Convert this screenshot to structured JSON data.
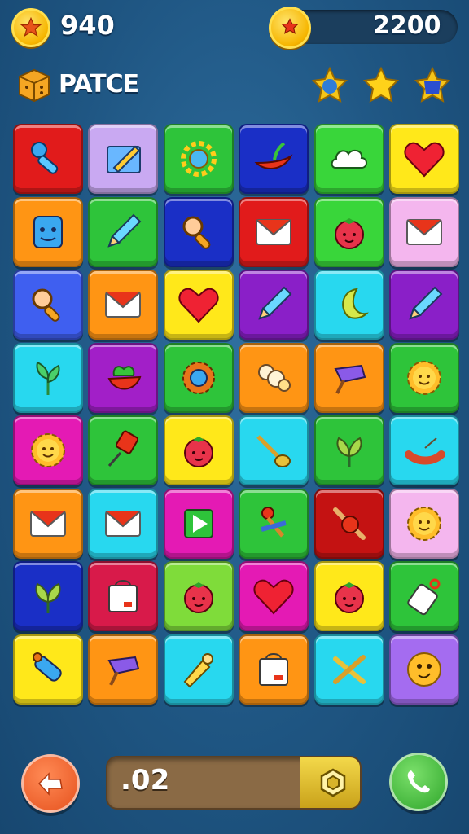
{
  "hud": {
    "coins": "940",
    "score": "2200",
    "level_label": "PATCE"
  },
  "stars": [
    "blue-star-icon",
    "gold-star-icon",
    "blue-cracked-star-icon"
  ],
  "board": {
    "columns": 6,
    "rows": 8,
    "tiles": [
      {
        "color": "#e11b1b",
        "icon": "key-icon"
      },
      {
        "color": "#c9a9f2",
        "icon": "edit-pencil-icon"
      },
      {
        "color": "#2ec43a",
        "icon": "sun-icon"
      },
      {
        "color": "#1a2fc6",
        "icon": "chili-pepper-icon"
      },
      {
        "color": "#39d63a",
        "icon": "cloud-icon"
      },
      {
        "color": "#ffe81a",
        "icon": "heart-icon"
      },
      {
        "color": "#ff9514",
        "icon": "robot-face-icon"
      },
      {
        "color": "#2ec43a",
        "icon": "pencil-icon"
      },
      {
        "color": "#1a2fc6",
        "icon": "magnifier-icon"
      },
      {
        "color": "#e11b1b",
        "icon": "envelope-icon"
      },
      {
        "color": "#39d63a",
        "icon": "tomato-face-icon"
      },
      {
        "color": "#f4b6ee",
        "icon": "envelope-icon"
      },
      {
        "color": "#3f5ff0",
        "icon": "magnifier-icon"
      },
      {
        "color": "#ff9514",
        "icon": "envelope-icon"
      },
      {
        "color": "#ffe81a",
        "icon": "heart-icon"
      },
      {
        "color": "#8a1fc8",
        "icon": "pencil-icon"
      },
      {
        "color": "#28d8ef",
        "icon": "moon-icon"
      },
      {
        "color": "#8a1fc8",
        "icon": "pencil-icon"
      },
      {
        "color": "#28d8ef",
        "icon": "sprout-icon"
      },
      {
        "color": "#a21fc8",
        "icon": "cherry-leaf-icon"
      },
      {
        "color": "#2ec43a",
        "icon": "gear-icon"
      },
      {
        "color": "#ff9514",
        "icon": "puff-cloud-icon"
      },
      {
        "color": "#ff9514",
        "icon": "paint-brush-icon"
      },
      {
        "color": "#2ec43a",
        "icon": "smiley-sun-icon"
      },
      {
        "color": "#e41ab4",
        "icon": "smiley-sun-icon"
      },
      {
        "color": "#2ec43a",
        "icon": "pushpin-icon"
      },
      {
        "color": "#ffe81a",
        "icon": "tomato-face-icon"
      },
      {
        "color": "#28d8ef",
        "icon": "spoon-icon"
      },
      {
        "color": "#2ec43a",
        "icon": "leaf-icon"
      },
      {
        "color": "#28d8ef",
        "icon": "sausage-icon"
      },
      {
        "color": "#ff9514",
        "icon": "envelope-icon"
      },
      {
        "color": "#28d8ef",
        "icon": "envelope-icon"
      },
      {
        "color": "#e41ab4",
        "icon": "play-icon"
      },
      {
        "color": "#2ec43a",
        "icon": "tools-icon"
      },
      {
        "color": "#c41212",
        "icon": "rolling-pin-icon"
      },
      {
        "color": "#f4b6ee",
        "icon": "smiley-sun-icon"
      },
      {
        "color": "#1a2fc6",
        "icon": "leaf-icon"
      },
      {
        "color": "#d81a4a",
        "icon": "shopping-bag-icon"
      },
      {
        "color": "#7fdc3a",
        "icon": "tomato-face-icon"
      },
      {
        "color": "#e41ab4",
        "icon": "heart-icon"
      },
      {
        "color": "#ffe81a",
        "icon": "tomato-face-icon"
      },
      {
        "color": "#2ec43a",
        "icon": "tag-icon"
      },
      {
        "color": "#ffe81a",
        "icon": "flashlight-icon"
      },
      {
        "color": "#ff9514",
        "icon": "paint-brush-icon"
      },
      {
        "color": "#28d8ef",
        "icon": "bell-icon"
      },
      {
        "color": "#ff9514",
        "icon": "shopping-bag-icon"
      },
      {
        "color": "#28d8ef",
        "icon": "crossed-sticks-icon"
      },
      {
        "color": "#a46cf0",
        "icon": "smiley-face-icon"
      }
    ]
  },
  "footer": {
    "progress_value": ".02",
    "progress_fraction": 0.76,
    "back_icon": "back-arrow-icon",
    "hint_icon": "hexagon-nut-icon",
    "call_icon": "phone-icon"
  }
}
